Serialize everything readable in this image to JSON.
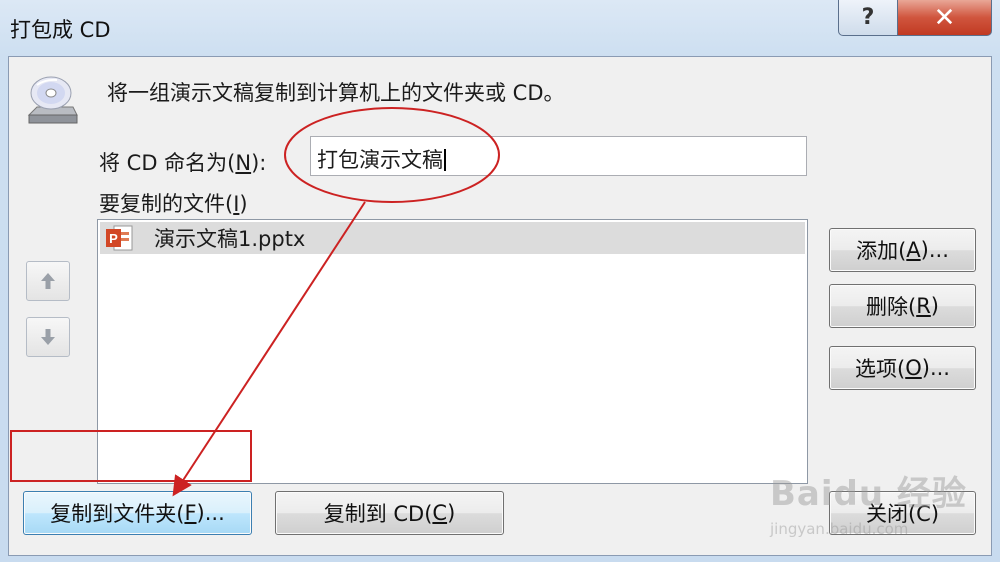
{
  "window": {
    "title": "打包成 CD",
    "help_glyph": "?",
    "close_glyph": "✕"
  },
  "main": {
    "description": "将一组演示文稿复制到计算机上的文件夹或 CD。",
    "name_label": "将 CD 命名为(N):",
    "name_value": "打包演示文稿",
    "files_label": "要复制的文件(I)",
    "files": [
      {
        "name": "演示文稿1.pptx",
        "icon": "powerpoint-file-icon",
        "selected": true
      }
    ],
    "move_up_icon": "arrow-up-icon",
    "move_down_icon": "arrow-down-icon"
  },
  "buttons": {
    "add": "添加(A)...",
    "delete": "删除(R)",
    "options": "选项(O)...",
    "copy_to_folder": "复制到文件夹(F)...",
    "copy_to_cd": "复制到 CD(C)",
    "close": "关闭(C)"
  },
  "watermark": {
    "brand": "Baidu 经验",
    "sub": "jingyan.baidu.com"
  },
  "colors": {
    "annotation": "#cc2222",
    "primary_button": "#bee6fd",
    "close_caption": "#c13a22"
  }
}
